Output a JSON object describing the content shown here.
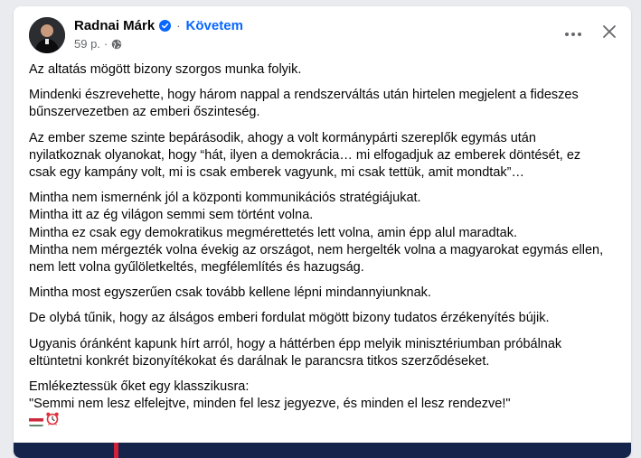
{
  "post": {
    "author": "Radnai Márk",
    "separator": "·",
    "follow_label": "Követem",
    "time": "59 p.",
    "meta_separator": "·",
    "icons": {
      "verified": "verified-badge-icon",
      "audience": "globe-icon",
      "more": "more-options-icon",
      "close": "close-icon",
      "reactions": [
        "hungarian-flag-icon",
        "alarm-clock-icon"
      ]
    },
    "paragraphs": [
      [
        "Az altatás mögött bizony szorgos munka folyik."
      ],
      [
        "Mindenki észrevehette, hogy három nappal a rendszerváltás után hirtelen megjelent a fideszes",
        "bűnszervezetben az emberi őszinteség."
      ],
      [
        "Az ember szeme szinte bepárásodik, ahogy a volt kormánypárti szereplők egymás után",
        "nyilatkoznak olyanokat, hogy “hát, ilyen a demokrácia… mi elfogadjuk az emberek döntését, ez",
        "csak egy kampány volt, mi is csak emberek vagyunk, mi csak tettük, amit mondtak”…"
      ],
      [
        "Mintha nem ismernénk jól a központi kommunikációs stratégiájukat.",
        "Mintha itt az ég világon semmi sem történt volna.",
        "Mintha ez csak egy demokratikus megmérettetés lett volna, amin épp alul maradtak.",
        "Mintha nem mérgezték volna évekig az országot, nem hergelték volna a magyarokat egymás ellen,",
        "nem lett volna gyűlöletkeltés, megfélemlítés és hazugság."
      ],
      [
        "Mintha most egyszerűen csak tovább kellene lépni mindannyiunknak."
      ],
      [
        "De olybá tűnik, hogy az álságos emberi fordulat mögött bizony tudatos érzékenyítés bújik."
      ],
      [
        "Ugyanis óránként kapunk hírt arról, hogy a háttérben épp melyik minisztériumban próbálnak",
        "eltüntetni konkrét bizonyítékokat és darálnak le parancsra titkos szerződéseket."
      ],
      [
        "Emlékeztessük őket egy klasszikusra:",
        "\"Semmi nem lesz elfelejtve, minden fel lesz jegyezve, és minden el lesz rendezve!\""
      ]
    ]
  },
  "colors": {
    "accent": "#0866ff",
    "secondary_text": "#65676b",
    "image_navy": "#14244a",
    "image_red": "#d0203a"
  }
}
